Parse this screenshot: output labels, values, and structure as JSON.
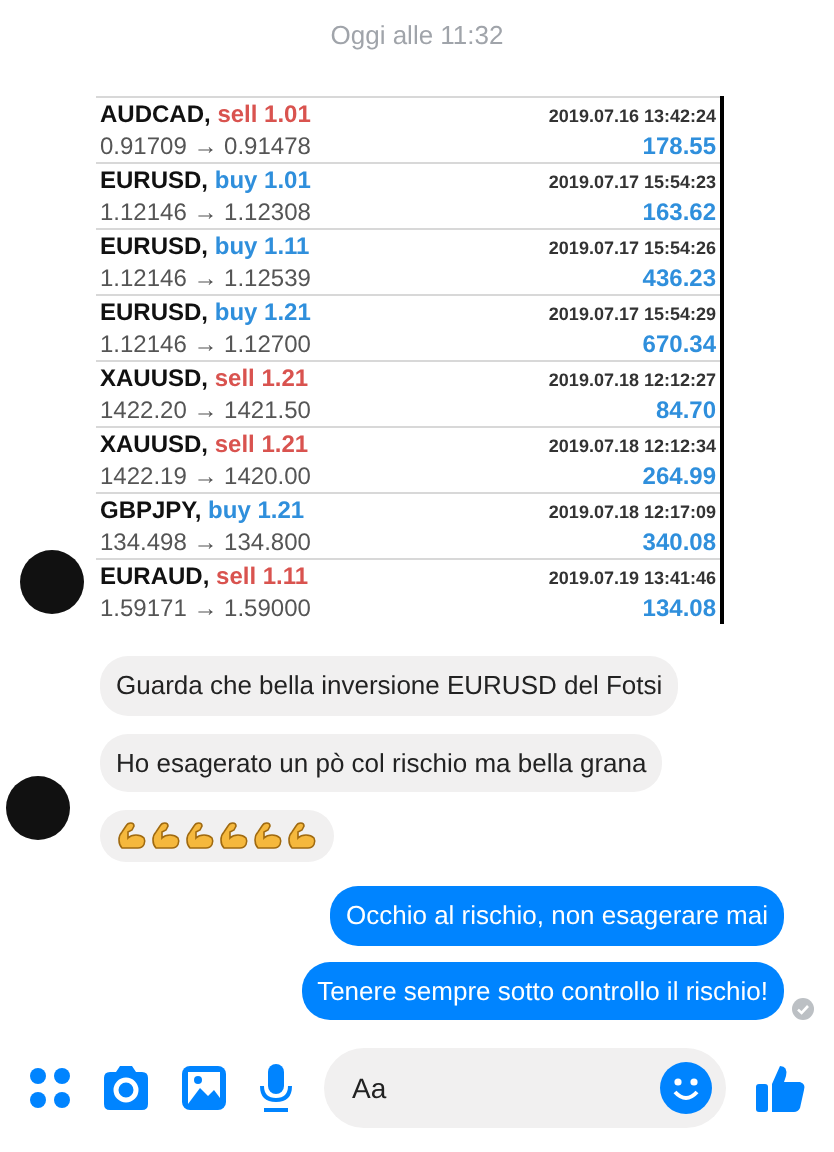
{
  "timestamp": "Oggi alle 11:32",
  "trades": [
    {
      "symbol": "AUDCAD,",
      "kind": "sell",
      "order": "sell 1.01",
      "time": "2019.07.16 13:42:24",
      "prices": "0.91709 → 0.91478",
      "profit": "178.55"
    },
    {
      "symbol": "EURUSD,",
      "kind": "buy",
      "order": "buy 1.01",
      "time": "2019.07.17 15:54:23",
      "prices": "1.12146 → 1.12308",
      "profit": "163.62"
    },
    {
      "symbol": "EURUSD,",
      "kind": "buy",
      "order": "buy 1.11",
      "time": "2019.07.17 15:54:26",
      "prices": "1.12146 → 1.12539",
      "profit": "436.23"
    },
    {
      "symbol": "EURUSD,",
      "kind": "buy",
      "order": "buy 1.21",
      "time": "2019.07.17 15:54:29",
      "prices": "1.12146 → 1.12700",
      "profit": "670.34"
    },
    {
      "symbol": "XAUUSD,",
      "kind": "sell",
      "order": "sell 1.21",
      "time": "2019.07.18 12:12:27",
      "prices": "1422.20 → 1421.50",
      "profit": "84.70"
    },
    {
      "symbol": "XAUUSD,",
      "kind": "sell",
      "order": "sell 1.21",
      "time": "2019.07.18 12:12:34",
      "prices": "1422.19 → 1420.00",
      "profit": "264.99"
    },
    {
      "symbol": "GBPJPY,",
      "kind": "buy",
      "order": "buy 1.21",
      "time": "2019.07.18 12:17:09",
      "prices": "134.498 → 134.800",
      "profit": "340.08"
    },
    {
      "symbol": "EURAUD,",
      "kind": "sell",
      "order": "sell 1.11",
      "time": "2019.07.19 13:41:46",
      "prices": "1.59171 → 1.59000",
      "profit": "134.08"
    }
  ],
  "incoming": [
    {
      "kind": "text",
      "text": "Guarda che bella inversione EURUSD del Fotsi"
    },
    {
      "kind": "text",
      "text": "Ho esagerato un pò col rischio ma bella grana"
    },
    {
      "kind": "emoji",
      "emojis": [
        {
          "kind": "flexed-biceps"
        },
        {
          "kind": "flexed-biceps"
        },
        {
          "kind": "flexed-biceps"
        },
        {
          "kind": "flexed-biceps"
        },
        {
          "kind": "flexed-biceps"
        },
        {
          "kind": "flexed-biceps"
        }
      ]
    }
  ],
  "outgoing": [
    {
      "text": "Occhio al rischio, non esagerare mai",
      "seen": false
    },
    {
      "text": "Tenere sempre sotto controllo il rischio!",
      "seen": true
    }
  ],
  "composer": {
    "placeholder": "Aa"
  }
}
